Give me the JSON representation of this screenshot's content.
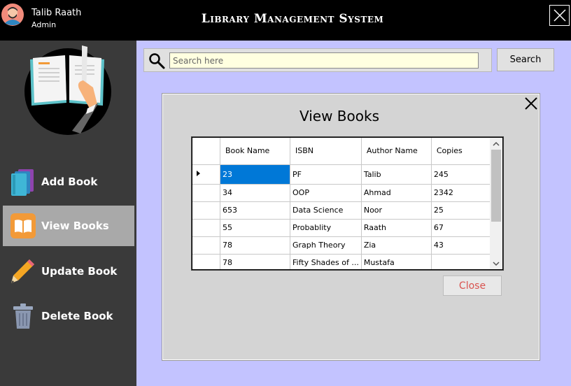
{
  "user": {
    "name": "Talib Raath",
    "role": "Admin"
  },
  "app": {
    "title": "Library Management System"
  },
  "sidebar": {
    "items": [
      {
        "label": "Add Book",
        "icon": "books-icon"
      },
      {
        "label": "View Books",
        "icon": "open-book-icon",
        "active": true
      },
      {
        "label": "Update Book",
        "icon": "pencil-icon"
      },
      {
        "label": "Delete Book",
        "icon": "trash-icon"
      }
    ]
  },
  "search": {
    "placeholder": "Search here",
    "value": "",
    "button_label": "Search"
  },
  "dialog": {
    "title": "View Books",
    "close_label": "Close",
    "table": {
      "headers": [
        "Book Name",
        "ISBN",
        "Author Name",
        "Copies"
      ],
      "rows": [
        [
          "23",
          "PF",
          "Talib",
          "245"
        ],
        [
          "34",
          "OOP",
          "Ahmad",
          "2342"
        ],
        [
          "653",
          "Data Science",
          "Noor",
          "25"
        ],
        [
          "55",
          "Probablity",
          "Raath",
          "67"
        ],
        [
          "78",
          "Graph Theory",
          "Zia",
          "43"
        ],
        [
          "78",
          "Fifty Shades of ...",
          "Mustafa",
          ""
        ]
      ]
    }
  },
  "colors": {
    "accent": "#0078d7",
    "main_bg": "#c3c3ff",
    "sidebar_bg": "#3a3a3a",
    "close_text": "#d9534f",
    "search_field": "#ffffe0"
  }
}
